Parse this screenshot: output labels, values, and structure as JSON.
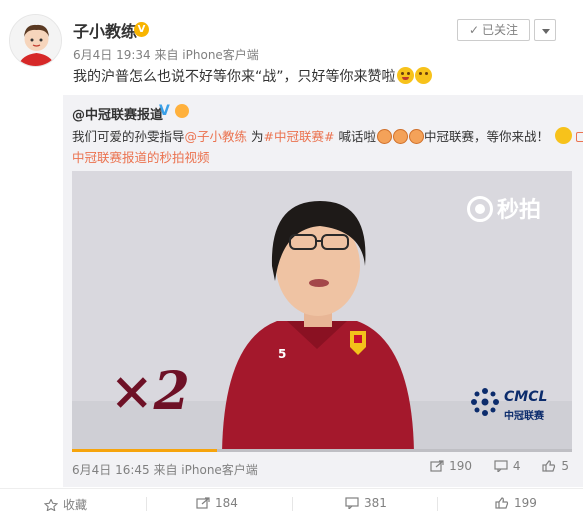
{
  "post": {
    "author": "子小教练",
    "verified": "V",
    "meta": "6月4日 19:34 来自 iPhone客户端",
    "follow_label": "已关注",
    "follow_check": "✓",
    "text": "我的沪普怎么也说不好等你来“战”，只好等你来赞啦"
  },
  "repost": {
    "author": "@中冠联赛报道",
    "verified": "V",
    "text_1": "我们可爱的孙雯指导",
    "mention": "@子小教练",
    "text_2": " 为",
    "topic": "#中冠联赛#",
    "text_3": " 喊话啦",
    "text_4": "中冠联赛，等你来战！",
    "video_link": "中冠联赛报道的秒拍视频",
    "video": {
      "watermark": "秒拍",
      "overlay_text": "×2",
      "logo_text": "CMCL",
      "logo_sub": "中冠联赛",
      "jersey_number": "5",
      "progress": 0.29
    },
    "meta": "6月4日 16:45 来自 iPhone客户端",
    "actions": {
      "reposts": "190",
      "comments": "4",
      "likes": "5"
    }
  },
  "footer": {
    "favorite_label": "收藏",
    "reposts": "184",
    "comments": "381",
    "likes": "199"
  },
  "colors": {
    "link": "#eb7350",
    "verified": "#f8b400",
    "repost_bg": "#f2f2f5",
    "progress": "#f6a40c"
  }
}
